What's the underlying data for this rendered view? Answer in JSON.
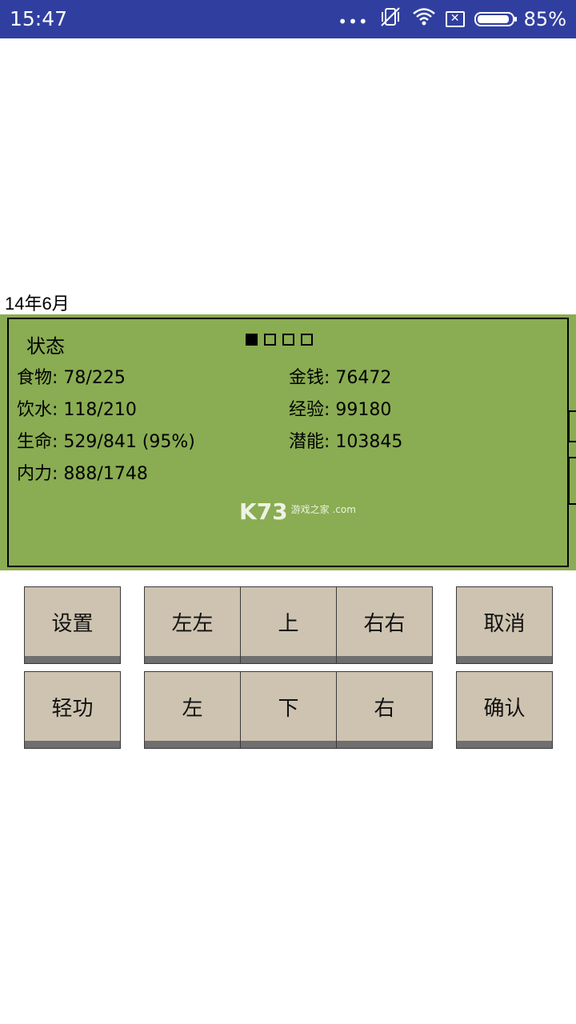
{
  "status_bar": {
    "time": "15:47",
    "battery": "85%",
    "dots": "•••"
  },
  "date": "14年6月",
  "panel": {
    "title": "状态",
    "pager": {
      "count": 4,
      "active": 0
    },
    "stats_left": [
      {
        "label": "食物",
        "value": "78/225"
      },
      {
        "label": "饮水",
        "value": "118/210"
      },
      {
        "label": "生命",
        "value": "529/841 (95%)"
      },
      {
        "label": "内力",
        "value": "888/1748"
      }
    ],
    "stats_right": [
      {
        "label": "金钱",
        "value": "76472"
      },
      {
        "label": "经验",
        "value": "99180"
      },
      {
        "label": "潜能",
        "value": "103845"
      }
    ],
    "watermark": {
      "main": "K73",
      "sub": "游戏之家 .com"
    }
  },
  "buttons": {
    "settings": "设置",
    "left_left": "左左",
    "up": "上",
    "right_right": "右右",
    "cancel": "取消",
    "qinggong": "轻功",
    "left": "左",
    "down": "下",
    "right": "右",
    "confirm": "确认"
  }
}
